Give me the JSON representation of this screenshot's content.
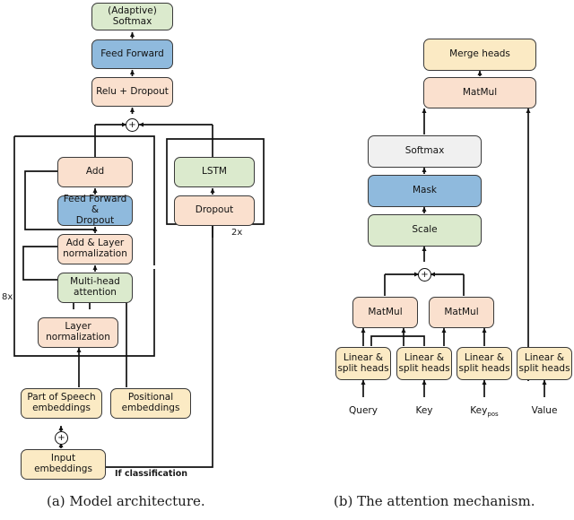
{
  "figure": {
    "caption_a": "(a) Model architecture.",
    "caption_b": "(b) The attention mechanism."
  },
  "colors": {
    "green": "#dbeacd",
    "blue": "#8fbadd",
    "peach": "#fae0ce",
    "yellow": "#fbeac4",
    "grey": "#f0f0f0",
    "stroke": "#3a3a3a",
    "line": "#111111"
  },
  "model_architecture": {
    "nodes": {
      "softmax": "(Adaptive)\nSoftmax",
      "softmax_line1": "(Adaptive)",
      "softmax_line2": "Softmax",
      "feed_forward": "Feed Forward",
      "relu_dropout": "Relu + Dropout",
      "add": "Add",
      "ff_dropout_line1": "Feed Forward &",
      "ff_dropout_line2": "Dropout",
      "add_layer_line1": "Add & Layer",
      "add_layer_line2": "normalization",
      "mha_line1": "Multi-head",
      "mha_line2": "attention",
      "layernorm_line1": "Layer",
      "layernorm_line2": "normalization",
      "lstm": "LSTM",
      "dropout": "Dropout",
      "pos_tag_line1": "Part of Speech",
      "pos_tag_line2": "embeddings",
      "positional_line1": "Positional",
      "positional_line2": "embeddings",
      "input_line1": "Input",
      "input_line2": "embeddings"
    },
    "labels": {
      "repeat_encoder": "8x",
      "repeat_lstm": "2x",
      "if_classification": "If classification",
      "adder": "+"
    }
  },
  "attention_mechanism": {
    "nodes": {
      "merge_heads": "Merge heads",
      "matmul_top": "MatMul",
      "softmax": "Softmax",
      "mask": "Mask",
      "scale": "Scale",
      "matmul_left": "MatMul",
      "matmul_right": "MatMul",
      "linear_line1": "Linear &",
      "linear_line2": "split heads"
    },
    "inputs": {
      "query": "Query",
      "key": "Key",
      "key_pos_base": "Key",
      "key_pos_sub": "pos",
      "value": "Value"
    },
    "labels": {
      "adder": "+"
    }
  }
}
